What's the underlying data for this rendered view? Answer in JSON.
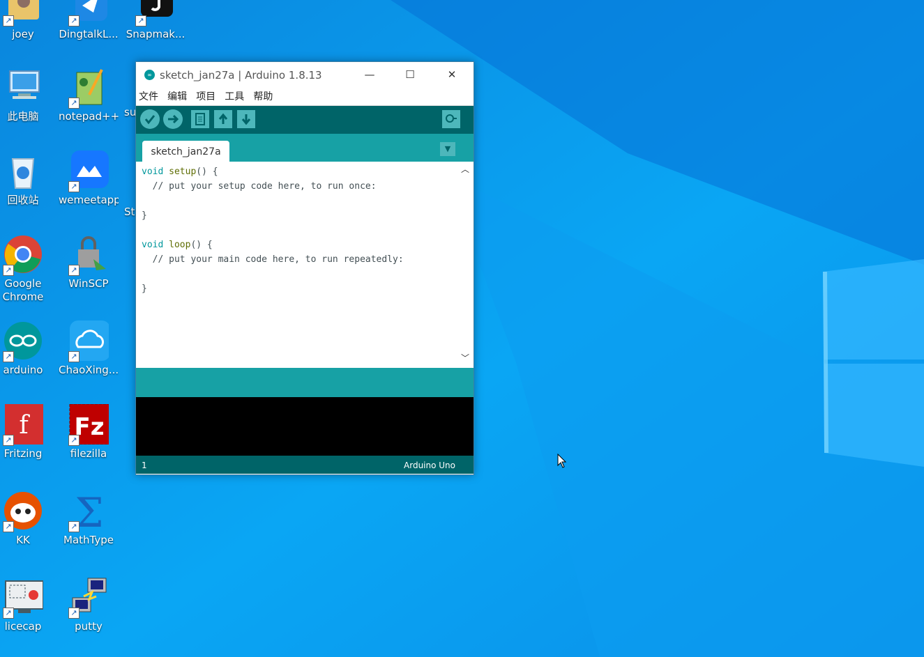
{
  "desktop": {
    "icons": [
      {
        "label": "joey",
        "icon": "user-folder-icon"
      },
      {
        "label": "DingtalkL...",
        "icon": "dingtalk-icon"
      },
      {
        "label": "Snapmak...",
        "icon": "snapmaker-icon"
      },
      {
        "label": "此电脑",
        "icon": "computer-icon"
      },
      {
        "label": "notepad++",
        "icon": "notepad-plus-plus-icon"
      },
      {
        "label": "su",
        "icon": "partial-icon"
      },
      {
        "label": "回收站",
        "icon": "recycle-bin-icon"
      },
      {
        "label": "wemeetapp",
        "icon": "wemeet-icon"
      },
      {
        "label": "St",
        "icon": "partial-icon"
      },
      {
        "label": "Google Chrome",
        "icon": "chrome-icon"
      },
      {
        "label": "WinSCP",
        "icon": "winscp-icon"
      },
      {
        "label": "arduino",
        "icon": "arduino-icon"
      },
      {
        "label": "ChaoXing...",
        "icon": "chaoxing-icon"
      },
      {
        "label": "Fritzing",
        "icon": "fritzing-icon"
      },
      {
        "label": "filezilla",
        "icon": "filezilla-icon"
      },
      {
        "label": "KK",
        "icon": "kk-icon"
      },
      {
        "label": "MathType",
        "icon": "mathtype-icon"
      },
      {
        "label": "licecap",
        "icon": "licecap-icon"
      },
      {
        "label": "putty",
        "icon": "putty-icon"
      }
    ]
  },
  "window": {
    "title": "sketch_jan27a | Arduino 1.8.13",
    "minimize": "—",
    "maximize": "☐",
    "close": "✕",
    "menu": [
      "文件",
      "编辑",
      "项目",
      "工具",
      "帮助"
    ],
    "toolbar": {
      "verify_icon": "checkmark-icon",
      "upload_icon": "arrow-right-icon",
      "new_icon": "new-file-icon",
      "open_icon": "open-arrow-up-icon",
      "save_icon": "save-arrow-down-icon",
      "serial_monitor_icon": "magnifier-icon"
    },
    "tab": "sketch_jan27a",
    "code": {
      "line1_kw": "void",
      "line1_fn": "setup",
      "line1_rest": "() {",
      "line2": "  // put your setup code here, to run once:",
      "line4": "}",
      "line6_kw": "void",
      "line6_fn": "loop",
      "line6_rest": "() {",
      "line7": "  // put your main code here, to run repeatedly:",
      "line9": "}"
    },
    "footer": {
      "line_number": "1",
      "board": "Arduino Uno"
    }
  },
  "colors": {
    "arduino_dark_teal": "#006468",
    "arduino_teal": "#17a1a5",
    "desktop_blue": "#0b8fe6"
  }
}
